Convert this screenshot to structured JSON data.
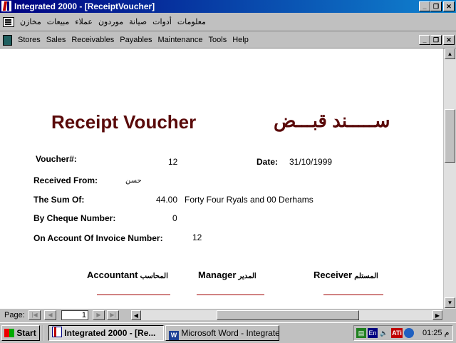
{
  "window": {
    "title": "Integrated 2000 - [ReceiptVoucher]"
  },
  "arabic_menu": {
    "items": [
      "مخازن",
      "مبيعات",
      "عملاء",
      "موردون",
      "صيانة",
      "أدوات",
      "معلومات"
    ]
  },
  "menu": {
    "items": [
      "Stores",
      "Sales",
      "Receivables",
      "Payables",
      "Maintenance",
      "Tools",
      "Help"
    ]
  },
  "voucher": {
    "title_en": "Receipt Voucher",
    "title_ar": "ســـــند قبـــض",
    "voucher_no_label": "Voucher#:",
    "voucher_no": "12",
    "date_label": "Date:",
    "date": "31/10/1999",
    "received_from_label": "Received From:",
    "received_from": "حسن",
    "sum_label": "The Sum Of:",
    "sum_amount": "44.00",
    "sum_words": "Forty Four Ryals and 00 Derhams",
    "cheque_label": "By Cheque Number:",
    "cheque_no": "0",
    "invoice_label": "On Account Of Invoice Number:",
    "invoice_no": "12",
    "accountant_en": "Accountant",
    "accountant_ar": "المحاسب",
    "manager_en": "Manager",
    "manager_ar": "المدير",
    "receiver_en": "Receiver",
    "receiver_ar": "المستلم"
  },
  "navigation": {
    "page_label": "Page:",
    "page_value": "1"
  },
  "taskbar": {
    "start_label": "Start",
    "tasks": [
      "Integrated 2000 - [Re...",
      "Microsoft Word - Integrate..."
    ],
    "tray_lang": "En",
    "clock": "01:25 م"
  }
}
